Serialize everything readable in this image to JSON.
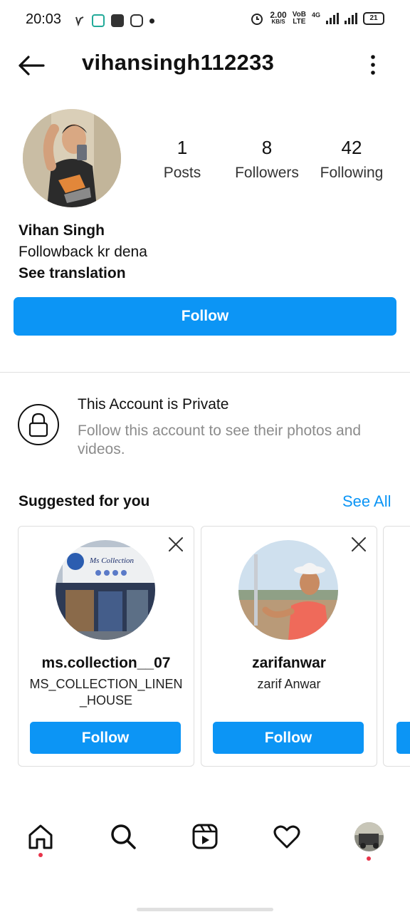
{
  "status_bar": {
    "time": "20:03",
    "speed_value": "2.00",
    "speed_unit": "KB/S",
    "vo_label": "VoB",
    "lte_label": "LTE",
    "net_label": "4G",
    "battery": "21"
  },
  "header": {
    "username": "vihansingh112233",
    "back_icon": "arrow-left-icon",
    "more_icon": "more-vertical-icon"
  },
  "profile": {
    "stats": [
      {
        "value": "1",
        "label": "Posts"
      },
      {
        "value": "8",
        "label": "Followers"
      },
      {
        "value": "42",
        "label": "Following"
      }
    ],
    "name": "Vihan Singh",
    "bio": "Followback kr dena",
    "see_translation": "See translation",
    "follow_label": "Follow"
  },
  "private": {
    "title": "This Account is Private",
    "text": "Follow this account to see their photos and videos."
  },
  "suggested": {
    "title": "Suggested for you",
    "see_all": "See All",
    "cards": [
      {
        "username": "ms.collection__07",
        "full_name": "MS_COLLECTION_LINEN_HOUSE",
        "follow": "Follow",
        "sign_text": "Ms Collection"
      },
      {
        "username": "zarifanwar",
        "full_name": "zarif Anwar",
        "follow": "Follow"
      }
    ]
  },
  "bottom_nav": [
    "home-icon",
    "search-icon",
    "reels-icon",
    "heart-icon",
    "profile-avatar"
  ],
  "colors": {
    "accent": "#0c95f5",
    "notification": "#e8344a"
  }
}
